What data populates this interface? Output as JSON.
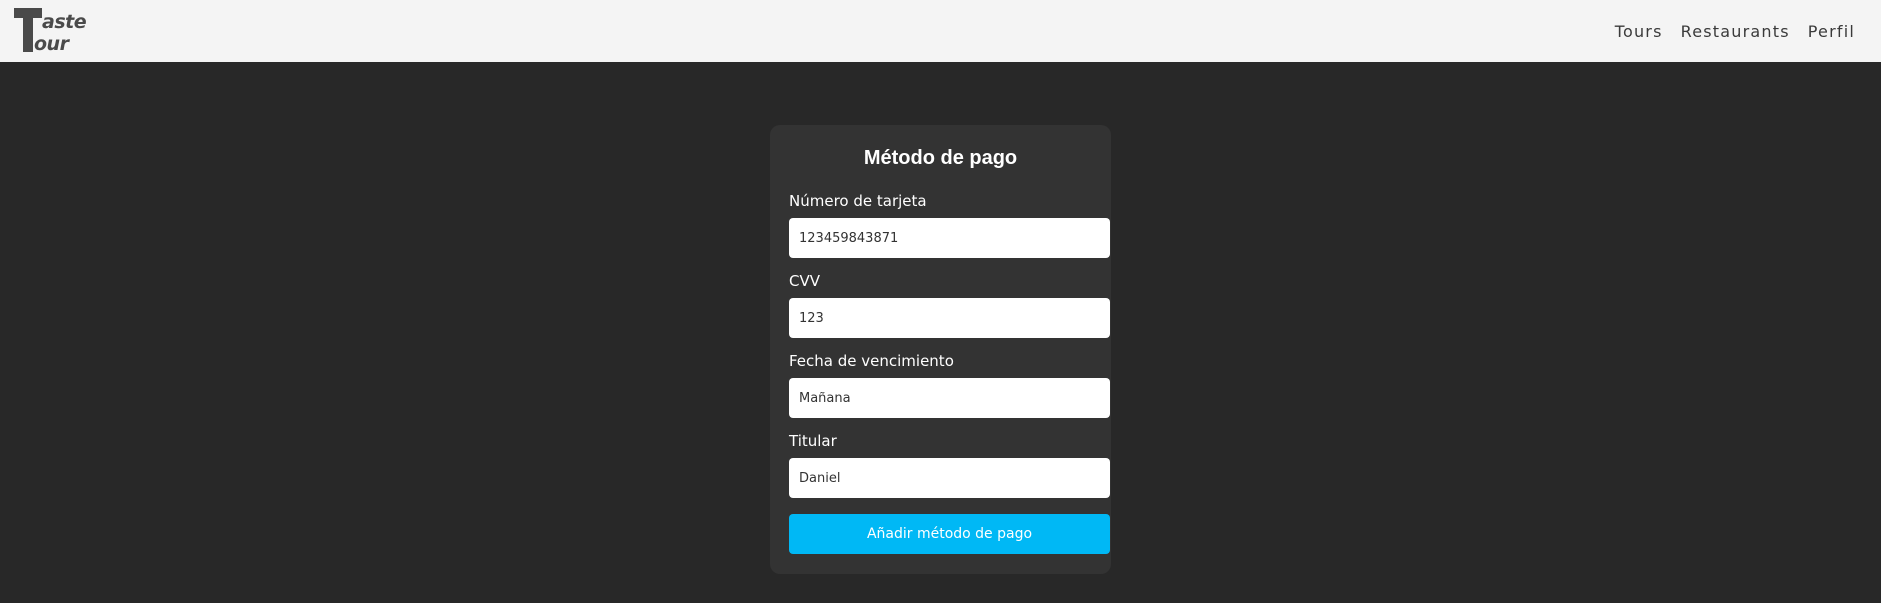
{
  "nav": {
    "logo_text": "Taste Tour",
    "links": [
      {
        "label": "Tours"
      },
      {
        "label": "Restaurants"
      },
      {
        "label": "Perfil"
      }
    ]
  },
  "form": {
    "title": "Método de pago",
    "fields": [
      {
        "label": "Número de tarjeta",
        "value": "123459843871"
      },
      {
        "label": "CVV",
        "value": "123"
      },
      {
        "label": "Fecha de vencimiento",
        "value": "Mañana"
      },
      {
        "label": "Titular",
        "value": "Daniel"
      }
    ],
    "submit_label": "Añadir método de pago"
  },
  "colors": {
    "background": "#282828",
    "navbar": "#f4f4f4",
    "card": "#333333",
    "accent": "#00b8f5",
    "logo": "#4a4a4a"
  }
}
